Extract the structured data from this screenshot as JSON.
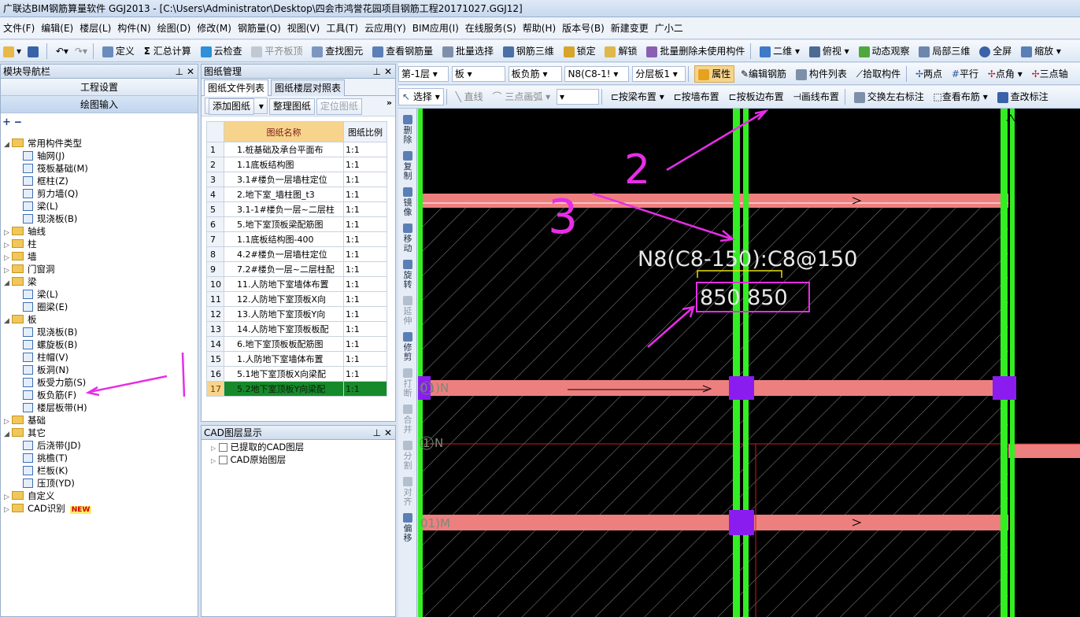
{
  "window": {
    "title": "广联达BIM钢筋算量软件 GGJ2013 - [C:\\Users\\Administrator\\Desktop\\四会市鸿誉花园项目钢筋工程20171027.GGJ12]"
  },
  "menu": [
    "文件(F)",
    "编辑(E)",
    "楼层(L)",
    "构件(N)",
    "绘图(D)",
    "修改(M)",
    "钢筋量(Q)",
    "视图(V)",
    "工具(T)",
    "云应用(Y)",
    "BIM应用(I)",
    "在线服务(S)",
    "帮助(H)",
    "版本号(B)",
    "新建变更",
    "广小二"
  ],
  "toolbar1": {
    "define": "定义",
    "sum": "汇总计算",
    "cloud_check": "云检查",
    "flat_top": "平齐板顶",
    "find": "查找图元",
    "view_rebar": "查看钢筋量",
    "batch_select": "批量选择",
    "rebar_3d": "钢筋三维",
    "lock": "锁定",
    "unlock": "解锁",
    "batch_delete": "批量删除未使用构件",
    "view2d": "二维",
    "plan_view": "俯视",
    "dynamic": "动态观察",
    "local3d": "局部三维",
    "fullscreen": "全屏",
    "zoom": "缩放"
  },
  "toolbar2": {
    "floor": "第-1层",
    "category": "板",
    "type": "板负筋",
    "component": "N8(C8-1!",
    "layer": "分层板1",
    "props": "属性",
    "edit_rebar": "编辑钢筋",
    "comp_list": "构件列表",
    "pick": "拾取构件",
    "two_point": "两点",
    "parallel": "平行",
    "point_angle": "点角",
    "three_point": "三点轴"
  },
  "toolbar3": {
    "select": "选择",
    "line": "直线",
    "arc": "三点画弧",
    "beam_place": "按梁布置",
    "wall_place": "按墙布置",
    "slab_edge": "按板边布置",
    "draw_line": "画线布置",
    "swap": "交换左右标注",
    "view_layout": "查看布筋",
    "edit_label": "查改标注"
  },
  "nav": {
    "title": "模块导航栏",
    "btn1": "工程设置",
    "btn2": "绘图输入",
    "tree": [
      {
        "t": "常用构件类型",
        "lvl": 0,
        "f": 1,
        "e": "-"
      },
      {
        "t": "轴网(J)",
        "lvl": 1
      },
      {
        "t": "筏板基础(M)",
        "lvl": 1
      },
      {
        "t": "框柱(Z)",
        "lvl": 1
      },
      {
        "t": "剪力墙(Q)",
        "lvl": 1
      },
      {
        "t": "梁(L)",
        "lvl": 1
      },
      {
        "t": "现浇板(B)",
        "lvl": 1
      },
      {
        "t": "轴线",
        "lvl": 0,
        "f": 1,
        "e": "+"
      },
      {
        "t": "柱",
        "lvl": 0,
        "f": 1,
        "e": "+"
      },
      {
        "t": "墙",
        "lvl": 0,
        "f": 1,
        "e": "+"
      },
      {
        "t": "门窗洞",
        "lvl": 0,
        "f": 1,
        "e": "+"
      },
      {
        "t": "梁",
        "lvl": 0,
        "f": 1,
        "e": "-"
      },
      {
        "t": "梁(L)",
        "lvl": 1
      },
      {
        "t": "圈梁(E)",
        "lvl": 1
      },
      {
        "t": "板",
        "lvl": 0,
        "f": 1,
        "e": "-"
      },
      {
        "t": "现浇板(B)",
        "lvl": 1
      },
      {
        "t": "螺旋板(B)",
        "lvl": 1
      },
      {
        "t": "柱帽(V)",
        "lvl": 1
      },
      {
        "t": "板洞(N)",
        "lvl": 1
      },
      {
        "t": "板受力筋(S)",
        "lvl": 1
      },
      {
        "t": "板负筋(F)",
        "lvl": 1
      },
      {
        "t": "楼层板带(H)",
        "lvl": 1
      },
      {
        "t": "基础",
        "lvl": 0,
        "f": 1,
        "e": "+"
      },
      {
        "t": "其它",
        "lvl": 0,
        "f": 1,
        "e": "-"
      },
      {
        "t": "后浇带(JD)",
        "lvl": 1
      },
      {
        "t": "挑檐(T)",
        "lvl": 1
      },
      {
        "t": "栏板(K)",
        "lvl": 1
      },
      {
        "t": "压顶(YD)",
        "lvl": 1
      },
      {
        "t": "自定义",
        "lvl": 0,
        "f": 1,
        "e": "+"
      },
      {
        "t": "CAD识别",
        "lvl": 0,
        "f": 1,
        "e": "+"
      }
    ],
    "new_badge": "NEW"
  },
  "drawing": {
    "title": "图纸管理",
    "tab1": "图纸文件列表",
    "tab2": "图纸楼层对照表",
    "add": "添加图纸",
    "organize": "整理图纸",
    "locate": "定位图纸",
    "col_name": "图纸名称",
    "col_scale": "图纸比例",
    "rows": [
      [
        "1",
        "1.桩基础及承台平面布",
        "1:1"
      ],
      [
        "2",
        "1.1底板结构图",
        "1:1"
      ],
      [
        "3",
        "3.1#楼负一层墙柱定位",
        "1:1"
      ],
      [
        "4",
        "2.地下室_墙柱图_t3",
        "1:1"
      ],
      [
        "5",
        "3.1-1#楼负一层~二层柱",
        "1:1"
      ],
      [
        "6",
        "5.地下室顶板梁配筋图",
        "1:1"
      ],
      [
        "7",
        "1.1底板结构图-400",
        "1:1"
      ],
      [
        "8",
        "4.2#楼负一层墙柱定位",
        "1:1"
      ],
      [
        "9",
        "7.2#楼负一层~二层柱配",
        "1:1"
      ],
      [
        "10",
        "11.人防地下室墙体布置",
        "1:1"
      ],
      [
        "11",
        "12.人防地下室顶板X向",
        "1:1"
      ],
      [
        "12",
        "13.人防地下室顶板Y向",
        "1:1"
      ],
      [
        "13",
        "14.人防地下室顶板板配",
        "1:1"
      ],
      [
        "14",
        "6.地下室顶板板配筋图",
        "1:1"
      ],
      [
        "15",
        "1.人防地下室墙体布置",
        "1:1"
      ],
      [
        "16",
        "5.1地下室顶板X向梁配",
        "1:1"
      ],
      [
        "17",
        "5.2地下室顶板Y向梁配",
        "1:1"
      ]
    ]
  },
  "cad": {
    "title": "CAD图层显示",
    "l1": "已提取的CAD图层",
    "l2": "CAD原始图层"
  },
  "vtools": [
    "删除",
    "复制",
    "镜像",
    "移动",
    "旋转",
    "延伸",
    "修剪",
    "打断",
    "合并",
    "分割",
    "对齐",
    "偏移"
  ],
  "canvas": {
    "label": "N8(C8-150):C8@150",
    "dims": "850 850",
    "axis1": "01)N",
    "axis2": "1-N",
    "axis3": "01)M",
    "ann2": "2",
    "ann3": "3",
    "colors": {
      "green": "#33ee22",
      "beam": "#ee7f7f",
      "purple": "#8a1cf0",
      "yellow": "#e8e000",
      "magenta": "#e62ee6",
      "text": "#e8e8e8"
    }
  }
}
